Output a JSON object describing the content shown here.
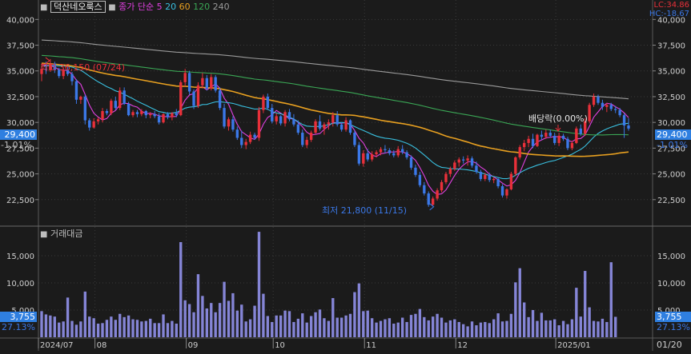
{
  "header": {
    "stock_name": "덕산네오룩스",
    "ma_label": "종가 단순",
    "ma_periods": [
      "5",
      "20",
      "60",
      "120",
      "240"
    ],
    "ma_colors": [
      "#e040e0",
      "#39c0e0",
      "#e8a020",
      "#3aa655",
      "#9a9a9a"
    ],
    "lc_text": "LC:34.86",
    "hc_text": "HC:-18.67"
  },
  "volume_panel": {
    "label": "거래대금"
  },
  "annotations": {
    "high": "최고 36,150 (07/24)",
    "low": "최저 21,800 (11/15)",
    "dividend": "배당락(0.00%)"
  },
  "price_axis": {
    "ticks": [
      "40,000",
      "37,500",
      "35,000",
      "32,500",
      "30,000",
      "27,500",
      "25,000",
      "22,500"
    ],
    "current": "29,400",
    "current_change": "-1.01%"
  },
  "volume_axis": {
    "ticks": [
      "15,000",
      "10,000",
      "5,000"
    ],
    "current": "3,755",
    "current_pct": "27.13%"
  },
  "date_axis": {
    "labels": [
      "2024/07",
      "08",
      "09",
      "10",
      "11",
      "12",
      "2025/01"
    ],
    "right_label": "01/20"
  },
  "colors": {
    "background": "#1b1b1b",
    "up": "#e8303a",
    "down": "#3b78e7",
    "volume": "#8585d6",
    "grid": "#3a3a3a",
    "badge": "#2f7fe0"
  },
  "chart_data": {
    "type": "candlestick",
    "price_range": [
      20000,
      41500
    ],
    "volume_range": [
      0,
      20000
    ],
    "ohlc": [
      [
        34700,
        35700,
        34000,
        35200
      ],
      [
        35200,
        35900,
        34700,
        35100
      ],
      [
        35100,
        36150,
        34900,
        35700
      ],
      [
        35700,
        35900,
        34800,
        35100
      ],
      [
        35100,
        35300,
        34300,
        34500
      ],
      [
        34500,
        35300,
        34200,
        35100
      ],
      [
        35100,
        35400,
        34500,
        34700
      ],
      [
        34700,
        34900,
        33600,
        34000
      ],
      [
        34000,
        34200,
        31800,
        32200
      ],
      [
        32200,
        32600,
        31800,
        32500
      ],
      [
        32500,
        32700,
        29800,
        30200
      ],
      [
        30200,
        30400,
        29200,
        29500
      ],
      [
        29500,
        30400,
        29400,
        30100
      ],
      [
        30100,
        30500,
        29800,
        30300
      ],
      [
        30300,
        31400,
        30000,
        31100
      ],
      [
        31100,
        31300,
        30700,
        30900
      ],
      [
        30900,
        32300,
        30700,
        32100
      ],
      [
        32100,
        32500,
        31200,
        31400
      ],
      [
        31400,
        33400,
        31200,
        33100
      ],
      [
        33100,
        33400,
        31700,
        31800
      ],
      [
        31800,
        32000,
        30600,
        30700
      ],
      [
        30700,
        31200,
        30500,
        31000
      ],
      [
        31000,
        31200,
        30500,
        30800
      ],
      [
        30800,
        31300,
        30600,
        31100
      ],
      [
        31100,
        31200,
        30400,
        30700
      ],
      [
        30700,
        31000,
        30400,
        30800
      ],
      [
        30800,
        31100,
        30400,
        30600
      ],
      [
        30600,
        30900,
        29800,
        30000
      ],
      [
        30000,
        30900,
        29900,
        30800
      ],
      [
        30800,
        31000,
        30300,
        30500
      ],
      [
        30500,
        31000,
        30200,
        30900
      ],
      [
        30900,
        31300,
        30500,
        30700
      ],
      [
        30700,
        34100,
        30600,
        33900
      ],
      [
        33900,
        35200,
        33500,
        34800
      ],
      [
        34800,
        35000,
        32700,
        33000
      ],
      [
        33000,
        33200,
        31300,
        31600
      ],
      [
        31600,
        33900,
        31400,
        33600
      ],
      [
        33600,
        34800,
        33300,
        34300
      ],
      [
        34300,
        34600,
        33100,
        33300
      ],
      [
        33300,
        34700,
        33100,
        34400
      ],
      [
        34400,
        34600,
        32900,
        33100
      ],
      [
        33100,
        33400,
        31200,
        31400
      ],
      [
        31400,
        31800,
        29400,
        29600
      ],
      [
        29600,
        30500,
        29200,
        30300
      ],
      [
        30300,
        30600,
        29100,
        29300
      ],
      [
        29300,
        29600,
        28300,
        28500
      ],
      [
        28500,
        29200,
        27500,
        27800
      ],
      [
        27800,
        28400,
        27400,
        28100
      ],
      [
        28100,
        29100,
        27900,
        28800
      ],
      [
        28800,
        29000,
        28300,
        28500
      ],
      [
        28500,
        31500,
        28200,
        31200
      ],
      [
        31200,
        32700,
        30900,
        32500
      ],
      [
        32500,
        32800,
        31200,
        31400
      ],
      [
        31400,
        31800,
        29900,
        30100
      ],
      [
        30100,
        30900,
        29800,
        30600
      ],
      [
        30600,
        30700,
        29700,
        29900
      ],
      [
        29900,
        31200,
        29600,
        31000
      ],
      [
        31000,
        31300,
        30100,
        30300
      ],
      [
        30300,
        30800,
        29600,
        29800
      ],
      [
        29800,
        30200,
        28800,
        29000
      ],
      [
        29000,
        29300,
        27600,
        27800
      ],
      [
        27800,
        28600,
        27500,
        28300
      ],
      [
        28300,
        29200,
        28100,
        29000
      ],
      [
        29000,
        30300,
        28900,
        30100
      ],
      [
        30100,
        30700,
        29200,
        29400
      ],
      [
        29400,
        30000,
        28800,
        29800
      ],
      [
        29800,
        30300,
        29300,
        30000
      ],
      [
        30000,
        31000,
        29600,
        30700
      ],
      [
        30700,
        31100,
        29600,
        29800
      ],
      [
        29800,
        30000,
        29100,
        29300
      ],
      [
        29300,
        30500,
        29100,
        30200
      ],
      [
        30200,
        30300,
        28800,
        29000
      ],
      [
        29000,
        29200,
        27600,
        27800
      ],
      [
        27800,
        28100,
        25800,
        26000
      ],
      [
        26000,
        27300,
        25700,
        27000
      ],
      [
        27000,
        27400,
        26200,
        26400
      ],
      [
        26400,
        27200,
        26200,
        26900
      ],
      [
        26900,
        27300,
        26600,
        27100
      ],
      [
        27100,
        27600,
        26800,
        27400
      ],
      [
        27400,
        27800,
        27000,
        27300
      ],
      [
        27300,
        27500,
        26800,
        27000
      ],
      [
        27000,
        27300,
        26600,
        26800
      ],
      [
        26800,
        27700,
        26600,
        27400
      ],
      [
        27400,
        27800,
        26900,
        27100
      ],
      [
        27100,
        27300,
        26400,
        26600
      ],
      [
        26600,
        26800,
        25400,
        25600
      ],
      [
        25600,
        25900,
        24700,
        24900
      ],
      [
        24900,
        25200,
        23700,
        23900
      ],
      [
        23900,
        24200,
        22900,
        23100
      ],
      [
        23100,
        23300,
        21800,
        22000
      ],
      [
        22000,
        22800,
        21900,
        22600
      ],
      [
        22600,
        23600,
        22400,
        23400
      ],
      [
        23400,
        24400,
        23200,
        24200
      ],
      [
        24200,
        25200,
        24000,
        25000
      ],
      [
        25000,
        25700,
        24700,
        25500
      ],
      [
        25500,
        26300,
        25300,
        26100
      ],
      [
        26100,
        26600,
        25700,
        26400
      ],
      [
        26400,
        26700,
        26000,
        26300
      ],
      [
        26300,
        26800,
        25800,
        26500
      ],
      [
        26500,
        26700,
        25600,
        25800
      ],
      [
        25800,
        26200,
        25000,
        25200
      ],
      [
        25200,
        25400,
        24300,
        24500
      ],
      [
        24500,
        25100,
        24300,
        24900
      ],
      [
        24900,
        25100,
        24200,
        24400
      ],
      [
        24400,
        24700,
        24100,
        24500
      ],
      [
        24500,
        24600,
        23600,
        23800
      ],
      [
        23800,
        24000,
        22700,
        22900
      ],
      [
        22900,
        23600,
        22600,
        23500
      ],
      [
        23500,
        25200,
        23400,
        25000
      ],
      [
        25000,
        26700,
        24800,
        26600
      ],
      [
        26600,
        27800,
        26400,
        27600
      ],
      [
        27600,
        28300,
        27200,
        28000
      ],
      [
        28000,
        28700,
        27600,
        28400
      ],
      [
        28400,
        28900,
        27500,
        27700
      ],
      [
        27700,
        28900,
        27600,
        28800
      ],
      [
        28800,
        29200,
        28300,
        28600
      ],
      [
        28600,
        29300,
        28400,
        29000
      ],
      [
        29000,
        29300,
        28500,
        28700
      ],
      [
        28700,
        29000,
        27800,
        28000
      ],
      [
        28000,
        29000,
        27700,
        28700
      ],
      [
        28700,
        28900,
        28200,
        28400
      ],
      [
        28400,
        28600,
        27300,
        27500
      ],
      [
        27500,
        28200,
        27300,
        28000
      ],
      [
        28000,
        29600,
        27900,
        29400
      ],
      [
        29400,
        29800,
        28700,
        28900
      ],
      [
        28900,
        30400,
        28700,
        30100
      ],
      [
        30100,
        31900,
        29900,
        31700
      ],
      [
        31700,
        32800,
        31500,
        32500
      ],
      [
        32500,
        32700,
        31700,
        31900
      ],
      [
        31900,
        32200,
        31200,
        31500
      ],
      [
        31500,
        31900,
        31000,
        31700
      ],
      [
        31700,
        31900,
        31100,
        31300
      ],
      [
        31300,
        31600,
        30900,
        31200
      ],
      [
        31200,
        31400,
        30500,
        30700
      ],
      [
        30700,
        30900,
        28500,
        29700
      ],
      [
        29700,
        30400,
        29200,
        29400
      ]
    ],
    "volume": [
      4800,
      4200,
      4000,
      3800,
      2700,
      2900,
      7300,
      3000,
      2300,
      2900,
      8400,
      3800,
      3500,
      2500,
      2600,
      3200,
      3800,
      3200,
      4300,
      3700,
      4000,
      3300,
      3200,
      2900,
      3000,
      3400,
      2600,
      2600,
      4200,
      2600,
      3000,
      2500,
      17500,
      6800,
      6100,
      4600,
      11600,
      7600,
      5300,
      6300,
      4600,
      6300,
      10200,
      6700,
      8100,
      4900,
      6000,
      2900,
      3300,
      5800,
      19400,
      8000,
      3900,
      2800,
      4000,
      4000,
      4900,
      4800,
      2800,
      3400,
      4400,
      2700,
      3900,
      4600,
      5100,
      3500,
      3000,
      7200,
      3600,
      3600,
      4000,
      4300,
      8300,
      9900,
      4800,
      4900,
      3500,
      2700,
      3000,
      3300,
      3500,
      2500,
      2700,
      3600,
      2800,
      4100,
      4300,
      5200,
      3700,
      3100,
      3800,
      4300,
      3600,
      2700,
      3100,
      3300,
      2800,
      2400,
      2000,
      2900,
      2200,
      2700,
      2800,
      2600,
      3300,
      4400,
      2900,
      3000,
      4300,
      10100,
      12700,
      6400,
      3700,
      5000,
      3000,
      4500,
      3100,
      3100,
      3300,
      2200,
      3000,
      2400,
      3300,
      9100,
      3800,
      12200,
      5500,
      3000,
      2900,
      3400,
      2800,
      13800,
      3755
    ]
  }
}
